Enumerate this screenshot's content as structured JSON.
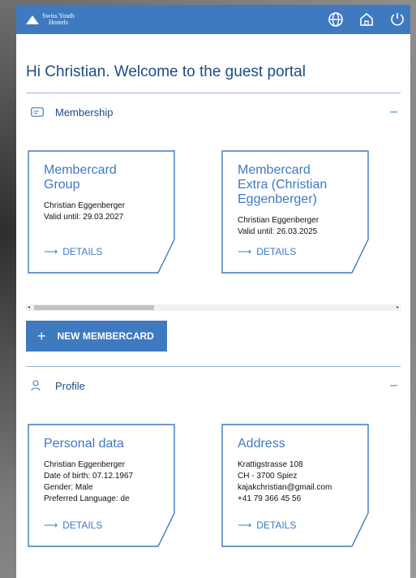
{
  "header": {
    "logo_line1": "Swiss Youth",
    "logo_line2": "Hostels",
    "icons": [
      "globe-icon",
      "home-icon",
      "power-icon"
    ]
  },
  "greeting": "Hi Christian. Welcome to the guest portal",
  "membership": {
    "label": "Membership",
    "toggle": "–",
    "cards": [
      {
        "title_lines": [
          "Membercard",
          "Group"
        ],
        "lines": [
          "Christian Eggenberger",
          "Valid until: 29.03.2027"
        ],
        "details": "DETAILS"
      },
      {
        "title_lines": [
          "Membercard",
          "Extra (Christian",
          "Eggenberger)"
        ],
        "lines": [
          "Christian Eggenberger",
          "Valid until: 26.03.2025"
        ],
        "details": "DETAILS"
      }
    ],
    "new_button": "NEW MEMBERCARD"
  },
  "profile": {
    "label": "Profile",
    "toggle": "–",
    "cards": [
      {
        "title_lines": [
          "Personal data"
        ],
        "lines": [
          "Christian Eggenberger",
          "Date of birth: 07.12.1967",
          "Gender: Male",
          "Preferred Language: de"
        ],
        "details": "DETAILS"
      },
      {
        "title_lines": [
          "Address"
        ],
        "lines": [
          "Krattigstrasse 108",
          "CH - 3700 Spiez",
          "kajakchristian@gmail.com",
          "+41 79 366 45 56"
        ],
        "details": "DETAILS"
      }
    ]
  },
  "colors": {
    "brand": "#3f79c0",
    "heading": "#1d4c86"
  }
}
